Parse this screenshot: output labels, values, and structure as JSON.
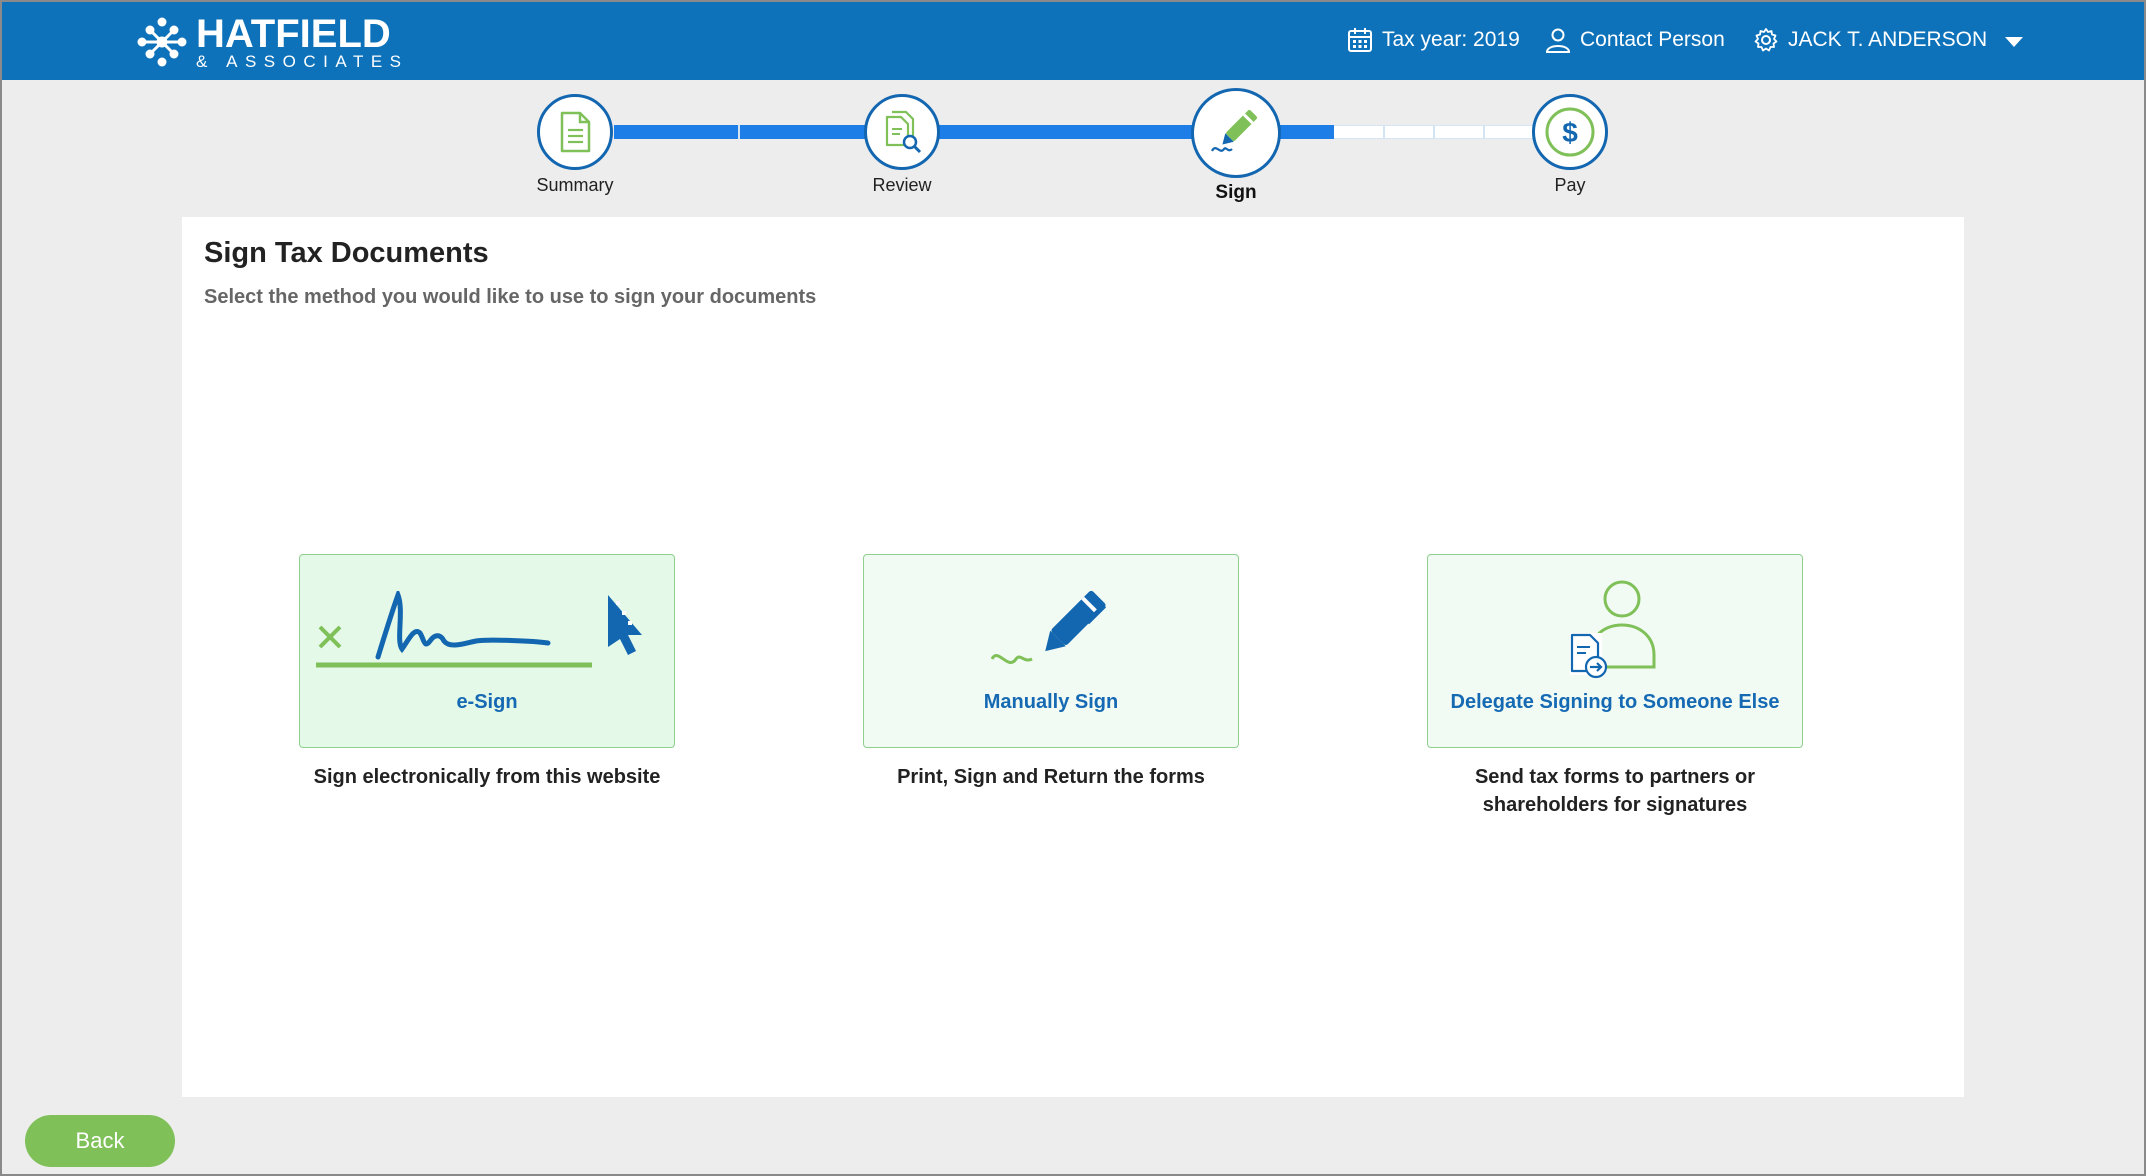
{
  "header": {
    "brand_name": "HATFIELD",
    "brand_sub": "& ASSOCIATES",
    "tax_year": "Tax year: 2019",
    "contact": "Contact Person",
    "user": "JACK T. ANDERSON"
  },
  "stepper": {
    "steps": [
      {
        "label": "Summary",
        "icon": "document-icon"
      },
      {
        "label": "Review",
        "icon": "review-document-icon"
      },
      {
        "label": "Sign",
        "icon": "pen-signature-icon"
      },
      {
        "label": "Pay",
        "icon": "dollar-icon"
      }
    ],
    "active_step": "Sign"
  },
  "main": {
    "title": "Sign Tax Documents",
    "subtitle": "Select the method you would like to use to sign your documents"
  },
  "options": [
    {
      "label": "e-Sign",
      "description": "Sign electronically from this website"
    },
    {
      "label": "Manually Sign",
      "description": "Print, Sign and Return the forms"
    },
    {
      "label": "Delegate Signing to Someone Else",
      "description_line1": "Send tax forms to partners or",
      "description_line2": "shareholders for signatures"
    }
  ],
  "footer": {
    "back_label": "Back"
  },
  "colors": {
    "header_bg": "#0e72ba",
    "accent_blue": "#1669b3",
    "progress_blue": "#1e7ee8",
    "accent_green": "#7fc058",
    "card_border": "#8fd08f"
  }
}
